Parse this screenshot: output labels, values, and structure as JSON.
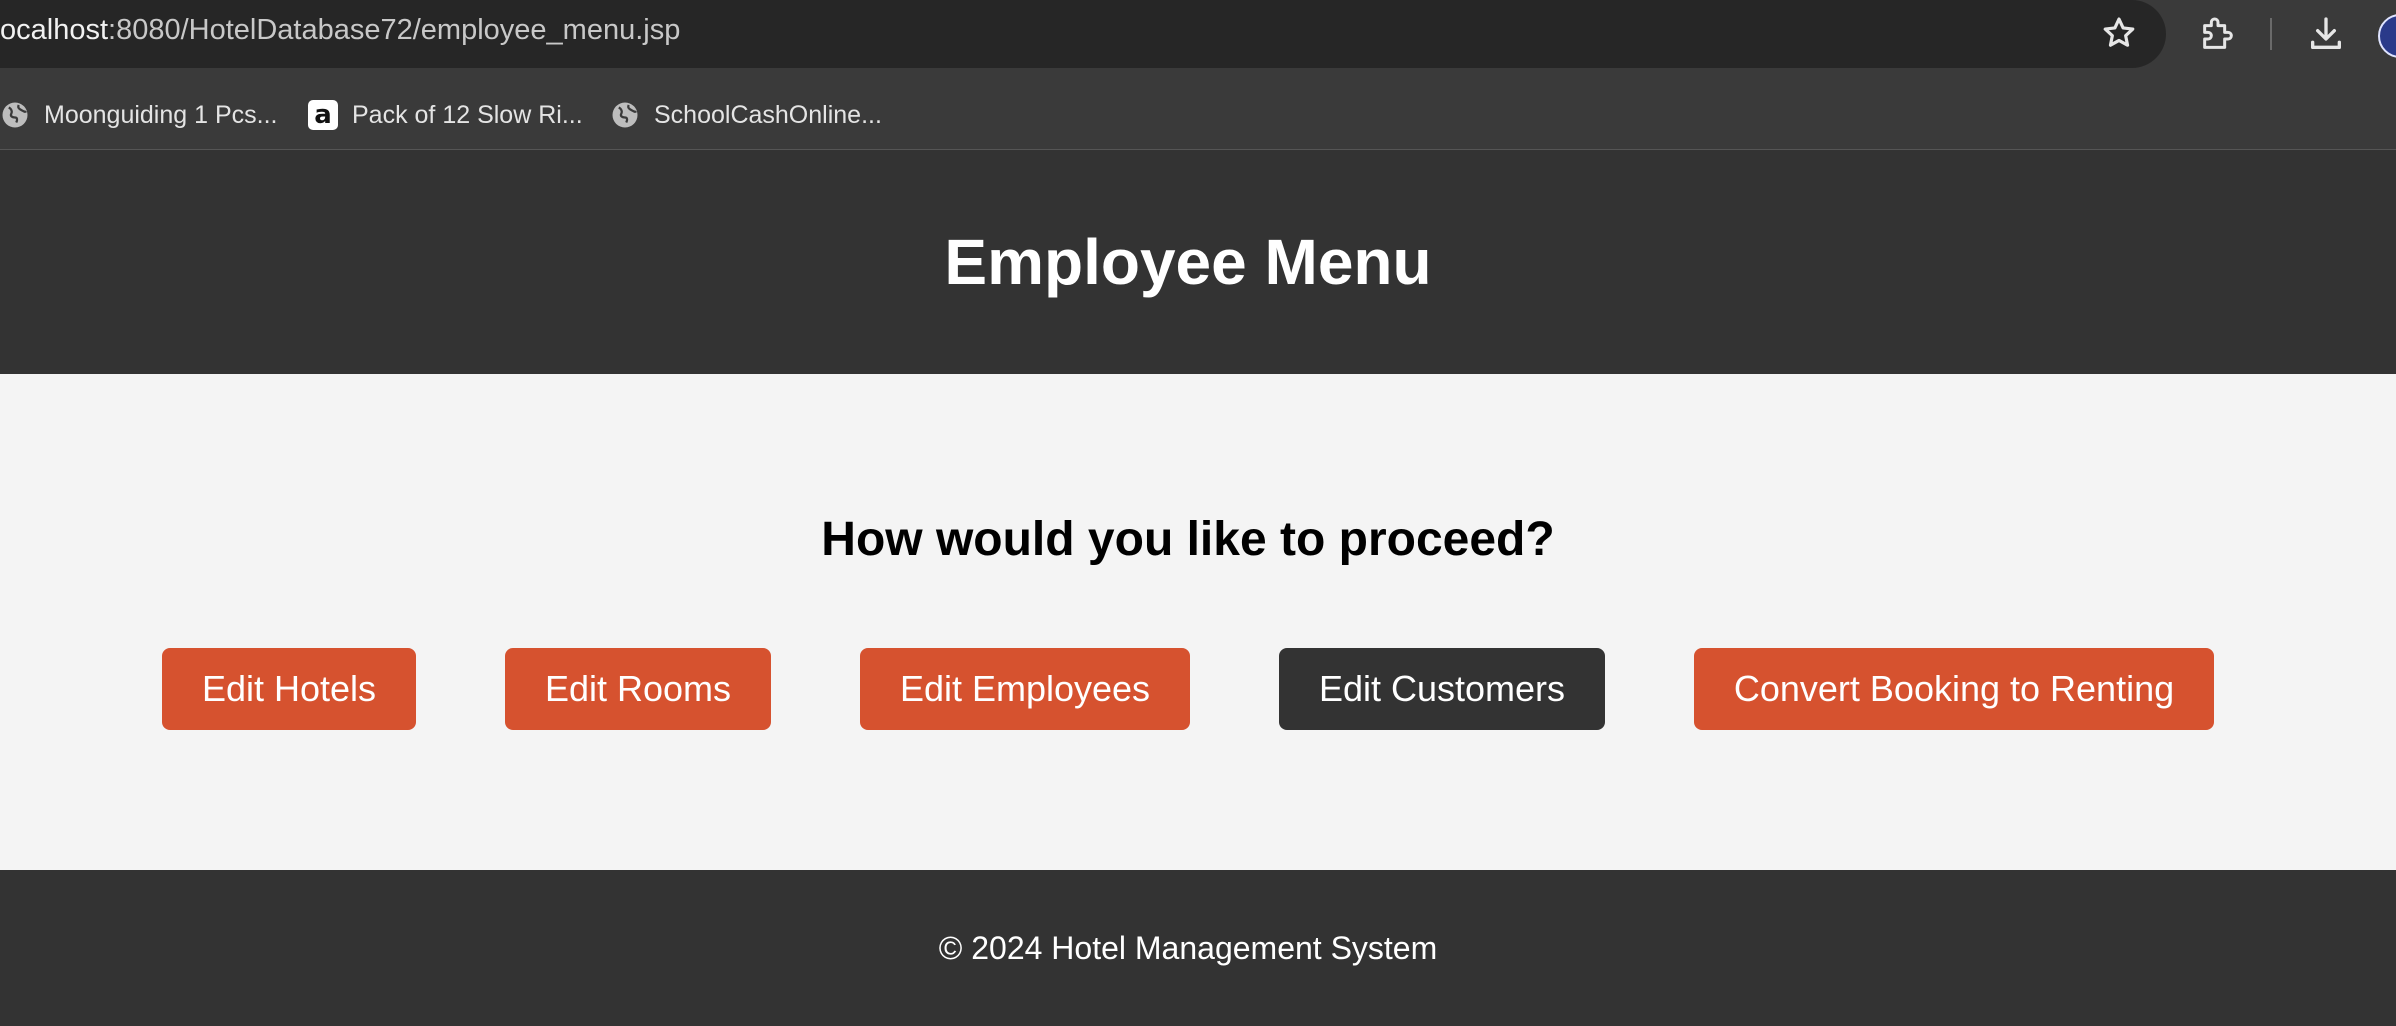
{
  "browser": {
    "url_host": "ocalhost",
    "url_path": ":8080/HotelDatabase72/employee_menu.jsp",
    "icons": [
      "star-icon",
      "extensions-icon",
      "download-icon",
      "avatar"
    ],
    "bookmarks": [
      {
        "label": "Moonguiding 1 Pcs...",
        "icon": "globe-icon"
      },
      {
        "label": "Pack of 12 Slow Ri...",
        "icon": "amazon-icon"
      },
      {
        "label": "SchoolCashOnline...",
        "icon": "globe-icon"
      }
    ]
  },
  "header": {
    "title": "Employee Menu"
  },
  "main": {
    "prompt": "How would you like to proceed?",
    "buttons": [
      {
        "label": "Edit Hotels",
        "color": "#d6522f"
      },
      {
        "label": "Edit Rooms",
        "color": "#d6522f"
      },
      {
        "label": "Edit Employees",
        "color": "#d6522f"
      },
      {
        "label": "Edit Customers",
        "color": "#333333"
      },
      {
        "label": "Convert Booking to Renting",
        "color": "#d6522f"
      }
    ]
  },
  "footer": {
    "text": "© 2024 Hotel Management System"
  }
}
